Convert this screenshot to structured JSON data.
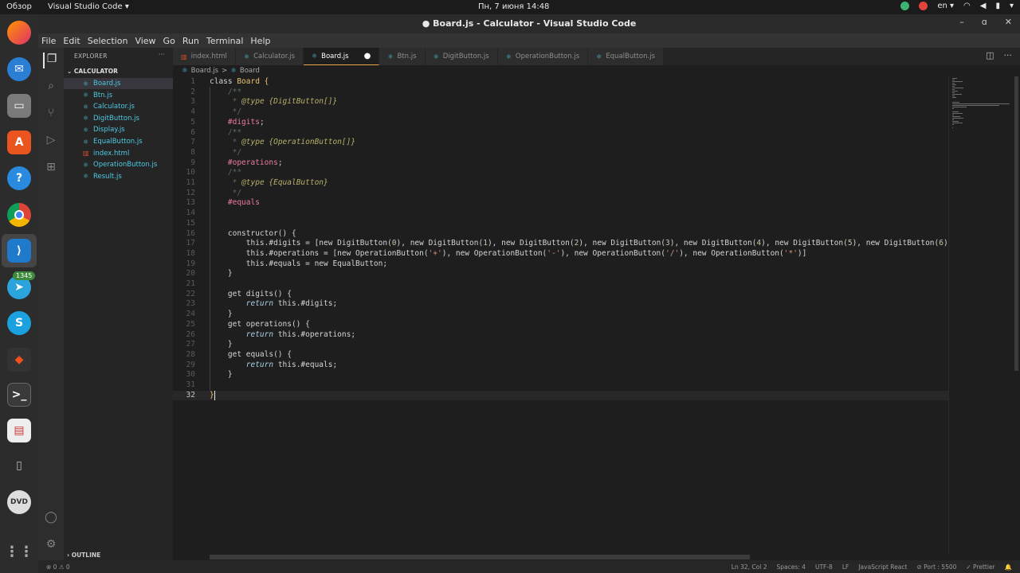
{
  "system": {
    "overview": "Обзор",
    "app_name": "Visual Studio Code ▾",
    "clock": "Пн, 7 июня  14:48",
    "lang": "en ▾",
    "tray_icons": [
      "nordvpn-icon",
      "chrome-icon",
      "wifi-icon",
      "volume-icon",
      "battery-icon"
    ]
  },
  "dock": {
    "apps": [
      "firefox",
      "thunderbird",
      "files",
      "software",
      "help",
      "chrome",
      "vscode",
      "telegram",
      "skype",
      "figma",
      "terminal",
      "document-viewer",
      "usb-drive",
      "dvd-drive",
      "avatar",
      "settings",
      "app-grid"
    ],
    "telegram_badge": "1345"
  },
  "window": {
    "title": "● Board.js - Calculator - Visual Studio Code",
    "controls": [
      "–",
      "ɑ",
      "✕"
    ]
  },
  "menu": [
    "File",
    "Edit",
    "Selection",
    "View",
    "Go",
    "Run",
    "Terminal",
    "Help"
  ],
  "sidebar": {
    "header": "EXPLORER",
    "dots": "···",
    "folder": "CALCULATOR",
    "files": [
      {
        "name": "Board.js",
        "type": "js",
        "selected": true
      },
      {
        "name": "Btn.js",
        "type": "js"
      },
      {
        "name": "Calculator.js",
        "type": "js"
      },
      {
        "name": "DigitButton.js",
        "type": "js"
      },
      {
        "name": "Display.js",
        "type": "js"
      },
      {
        "name": "EqualButton.js",
        "type": "js"
      },
      {
        "name": "index.html",
        "type": "html"
      },
      {
        "name": "OperationButton.js",
        "type": "js"
      },
      {
        "name": "Result.js",
        "type": "js"
      }
    ],
    "outline": "OUTLINE"
  },
  "tabs": [
    {
      "name": "index.html",
      "type": "html"
    },
    {
      "name": "Calculator.js",
      "type": "js"
    },
    {
      "name": "Board.js",
      "type": "js",
      "active": true,
      "modified": true
    },
    {
      "name": "Btn.js",
      "type": "js"
    },
    {
      "name": "DigitButton.js",
      "type": "js"
    },
    {
      "name": "OperationButton.js",
      "type": "js"
    },
    {
      "name": "EqualButton.js",
      "type": "js"
    }
  ],
  "breadcrumb": {
    "file": "Board.js",
    "separator": ">",
    "symbol": "Board"
  },
  "editor": {
    "current_line": 32,
    "lines": [
      {
        "n": "1",
        "tokens": [
          [
            "kw",
            "class "
          ],
          [
            "cls",
            "Board "
          ],
          [
            "cls",
            "{"
          ]
        ]
      },
      {
        "n": "2",
        "tokens": [
          [
            "pad",
            "    "
          ],
          [
            "cmt",
            "/**"
          ]
        ]
      },
      {
        "n": "3",
        "tokens": [
          [
            "pad",
            "     "
          ],
          [
            "cmt",
            "* "
          ],
          [
            "jsdoc",
            "@type {DigitButton[]}"
          ]
        ]
      },
      {
        "n": "4",
        "tokens": [
          [
            "pad",
            "     "
          ],
          [
            "cmt",
            "*/"
          ]
        ]
      },
      {
        "n": "5",
        "tokens": [
          [
            "pad",
            "    "
          ],
          [
            "priv",
            "#digits"
          ],
          [
            "kw",
            ";"
          ]
        ]
      },
      {
        "n": "6",
        "tokens": [
          [
            "pad",
            "    "
          ],
          [
            "cmt",
            "/**"
          ]
        ]
      },
      {
        "n": "7",
        "tokens": [
          [
            "pad",
            "     "
          ],
          [
            "cmt",
            "* "
          ],
          [
            "jsdoc",
            "@type {OperationButton[]}"
          ]
        ]
      },
      {
        "n": "8",
        "tokens": [
          [
            "pad",
            "     "
          ],
          [
            "cmt",
            "*/"
          ]
        ]
      },
      {
        "n": "9",
        "tokens": [
          [
            "pad",
            "    "
          ],
          [
            "priv",
            "#operations"
          ],
          [
            "kw",
            ";"
          ]
        ]
      },
      {
        "n": "10",
        "tokens": [
          [
            "pad",
            "    "
          ],
          [
            "cmt",
            "/**"
          ]
        ]
      },
      {
        "n": "11",
        "tokens": [
          [
            "pad",
            "     "
          ],
          [
            "cmt",
            "* "
          ],
          [
            "jsdoc",
            "@type {EqualButton}"
          ]
        ]
      },
      {
        "n": "12",
        "tokens": [
          [
            "pad",
            "     "
          ],
          [
            "cmt",
            "*/"
          ]
        ]
      },
      {
        "n": "13",
        "tokens": [
          [
            "pad",
            "    "
          ],
          [
            "priv",
            "#equals"
          ]
        ]
      },
      {
        "n": "14",
        "tokens": []
      },
      {
        "n": "15",
        "tokens": []
      },
      {
        "n": "16",
        "tokens": [
          [
            "pad",
            "    "
          ],
          [
            "fn",
            "constructor() {"
          ]
        ]
      },
      {
        "n": "17",
        "tokens": [
          [
            "pad",
            "        "
          ],
          [
            "this",
            "this.#digits = "
          ],
          [
            "kw",
            "[new DigitButton("
          ],
          [
            "num",
            "0"
          ],
          [
            "kw",
            "), new DigitButton("
          ],
          [
            "num",
            "1"
          ],
          [
            "kw",
            "), new DigitButton("
          ],
          [
            "num",
            "2"
          ],
          [
            "kw",
            "), new DigitButton("
          ],
          [
            "num",
            "3"
          ],
          [
            "kw",
            "), new DigitButton("
          ],
          [
            "num",
            "4"
          ],
          [
            "kw",
            "), new DigitButton("
          ],
          [
            "num",
            "5"
          ],
          [
            "kw",
            "), new DigitButton("
          ],
          [
            "num",
            "6"
          ],
          [
            "kw",
            "), n"
          ]
        ]
      },
      {
        "n": "18",
        "tokens": [
          [
            "pad",
            "        "
          ],
          [
            "this",
            "this.#operations = "
          ],
          [
            "kw",
            "[new OperationButton("
          ],
          [
            "str",
            "'+'"
          ],
          [
            "kw",
            "), new OperationButton("
          ],
          [
            "str",
            "'-'"
          ],
          [
            "kw",
            "), new OperationButton("
          ],
          [
            "str",
            "'/'"
          ],
          [
            "kw",
            "), new OperationButton("
          ],
          [
            "str",
            "'*'"
          ],
          [
            "kw",
            ")]"
          ]
        ]
      },
      {
        "n": "19",
        "tokens": [
          [
            "pad",
            "        "
          ],
          [
            "this",
            "this.#equals = "
          ],
          [
            "kw",
            "new EqualButton;"
          ]
        ]
      },
      {
        "n": "20",
        "tokens": [
          [
            "pad",
            "    "
          ],
          [
            "kw",
            "}"
          ]
        ]
      },
      {
        "n": "21",
        "tokens": []
      },
      {
        "n": "22",
        "tokens": [
          [
            "pad",
            "    "
          ],
          [
            "fn",
            "get digits() {"
          ]
        ]
      },
      {
        "n": "23",
        "tokens": [
          [
            "pad",
            "        "
          ],
          [
            "ret",
            "return "
          ],
          [
            "this",
            "this.#digits;"
          ]
        ]
      },
      {
        "n": "24",
        "tokens": [
          [
            "pad",
            "    "
          ],
          [
            "kw",
            "}"
          ]
        ]
      },
      {
        "n": "25",
        "tokens": [
          [
            "pad",
            "    "
          ],
          [
            "fn",
            "get operations() {"
          ]
        ]
      },
      {
        "n": "26",
        "tokens": [
          [
            "pad",
            "        "
          ],
          [
            "ret",
            "return "
          ],
          [
            "this",
            "this.#operations;"
          ]
        ]
      },
      {
        "n": "27",
        "tokens": [
          [
            "pad",
            "    "
          ],
          [
            "kw",
            "}"
          ]
        ]
      },
      {
        "n": "28",
        "tokens": [
          [
            "pad",
            "    "
          ],
          [
            "fn",
            "get equals() {"
          ]
        ]
      },
      {
        "n": "29",
        "tokens": [
          [
            "pad",
            "        "
          ],
          [
            "ret",
            "return "
          ],
          [
            "this",
            "this.#equals;"
          ]
        ]
      },
      {
        "n": "30",
        "tokens": [
          [
            "pad",
            "    "
          ],
          [
            "kw",
            "}"
          ]
        ]
      },
      {
        "n": "31",
        "tokens": []
      },
      {
        "n": "32",
        "tokens": [
          [
            "cls",
            "}"
          ]
        ]
      }
    ]
  },
  "status": {
    "problems": "⊗ 0  ⚠ 0",
    "items": [
      "Ln 32, Col 2",
      "Spaces: 4",
      "UTF-8",
      "LF",
      "JavaScript React",
      "⊘ Port : 5500",
      "✓ Prettier",
      "🔔"
    ]
  },
  "colors": {
    "accent": "#e8a84a",
    "js_icon": "#4ec9e0",
    "html_icon": "#e44d26"
  }
}
